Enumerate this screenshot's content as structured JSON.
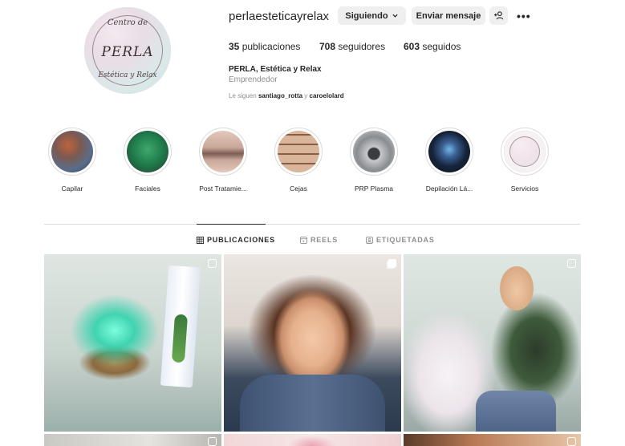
{
  "profile": {
    "username": "perlaesteticayrelax",
    "avatar_text_top": "Centro de",
    "avatar_text_mid": "PERLA",
    "avatar_text_bottom": "Estética y Relax",
    "follow_button": "Siguiendo",
    "message_button": "Enviar mensaje",
    "stats": {
      "posts_count": "35",
      "posts_label": "publicaciones",
      "followers_count": "708",
      "followers_label": "seguidores",
      "following_count": "603",
      "following_label": "seguidos"
    },
    "full_name": "PERLA, Estética y Relax",
    "category": "Emprendedor",
    "followed_by_prefix": "Le siguen",
    "followed_by_user1": "santiago_rotta",
    "followed_by_joiner": "y",
    "followed_by_user2": "caroelolard"
  },
  "highlights": [
    {
      "label": "Capilar",
      "color_a": "#5a6d8a",
      "color_b": "#c0623b"
    },
    {
      "label": "Faciales",
      "color_a": "#1e7a4a",
      "color_b": "#3fa86b"
    },
    {
      "label": "Post Tratamie...",
      "color_a": "#c9a89a",
      "color_b": "#e3c8bb"
    },
    {
      "label": "Cejas",
      "color_a": "#8a5e45",
      "color_b": "#d9b59a"
    },
    {
      "label": "PRP Plasma",
      "color_a": "#6f7376",
      "color_b": "#c7c9cb"
    },
    {
      "label": "Depilación Lá...",
      "color_a": "#16243a",
      "color_b": "#3a5f91"
    },
    {
      "label": "Servicios",
      "color_a": "#f0e2ea",
      "color_b": "#d8ece9"
    }
  ],
  "tabs": {
    "posts": "PUBLICACIONES",
    "reels": "REELS",
    "tagged": "ETIQUETADAS"
  },
  "posts": [
    {
      "alt": "Difusor de aromas iluminado en verde",
      "type": "reel"
    },
    {
      "alt": "Maquillaje de ojos con delineado",
      "type": "carousel"
    },
    {
      "alt": "Sesión de maquillaje profesional",
      "type": "reel"
    }
  ]
}
